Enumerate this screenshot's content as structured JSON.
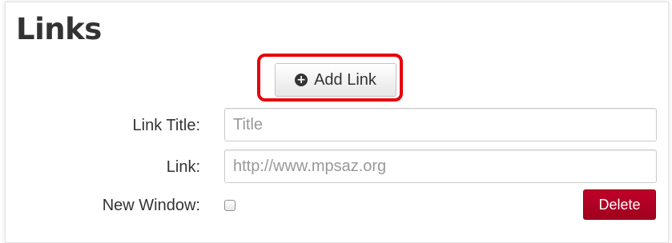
{
  "section": {
    "title": "Links"
  },
  "buttons": {
    "add_link_label": "Add Link",
    "add_link_icon": "plus-circle-icon",
    "delete_label": "Delete"
  },
  "form": {
    "link_title_label": "Link Title:",
    "link_title_value": "",
    "link_title_placeholder": "Title",
    "link_label": "Link:",
    "link_value": "",
    "link_placeholder": "http://www.mpsaz.org",
    "new_window_label": "New Window:",
    "new_window_checked": false
  },
  "colors": {
    "highlight": "#e8000b",
    "delete_button": "#b00024",
    "text": "#333333"
  }
}
